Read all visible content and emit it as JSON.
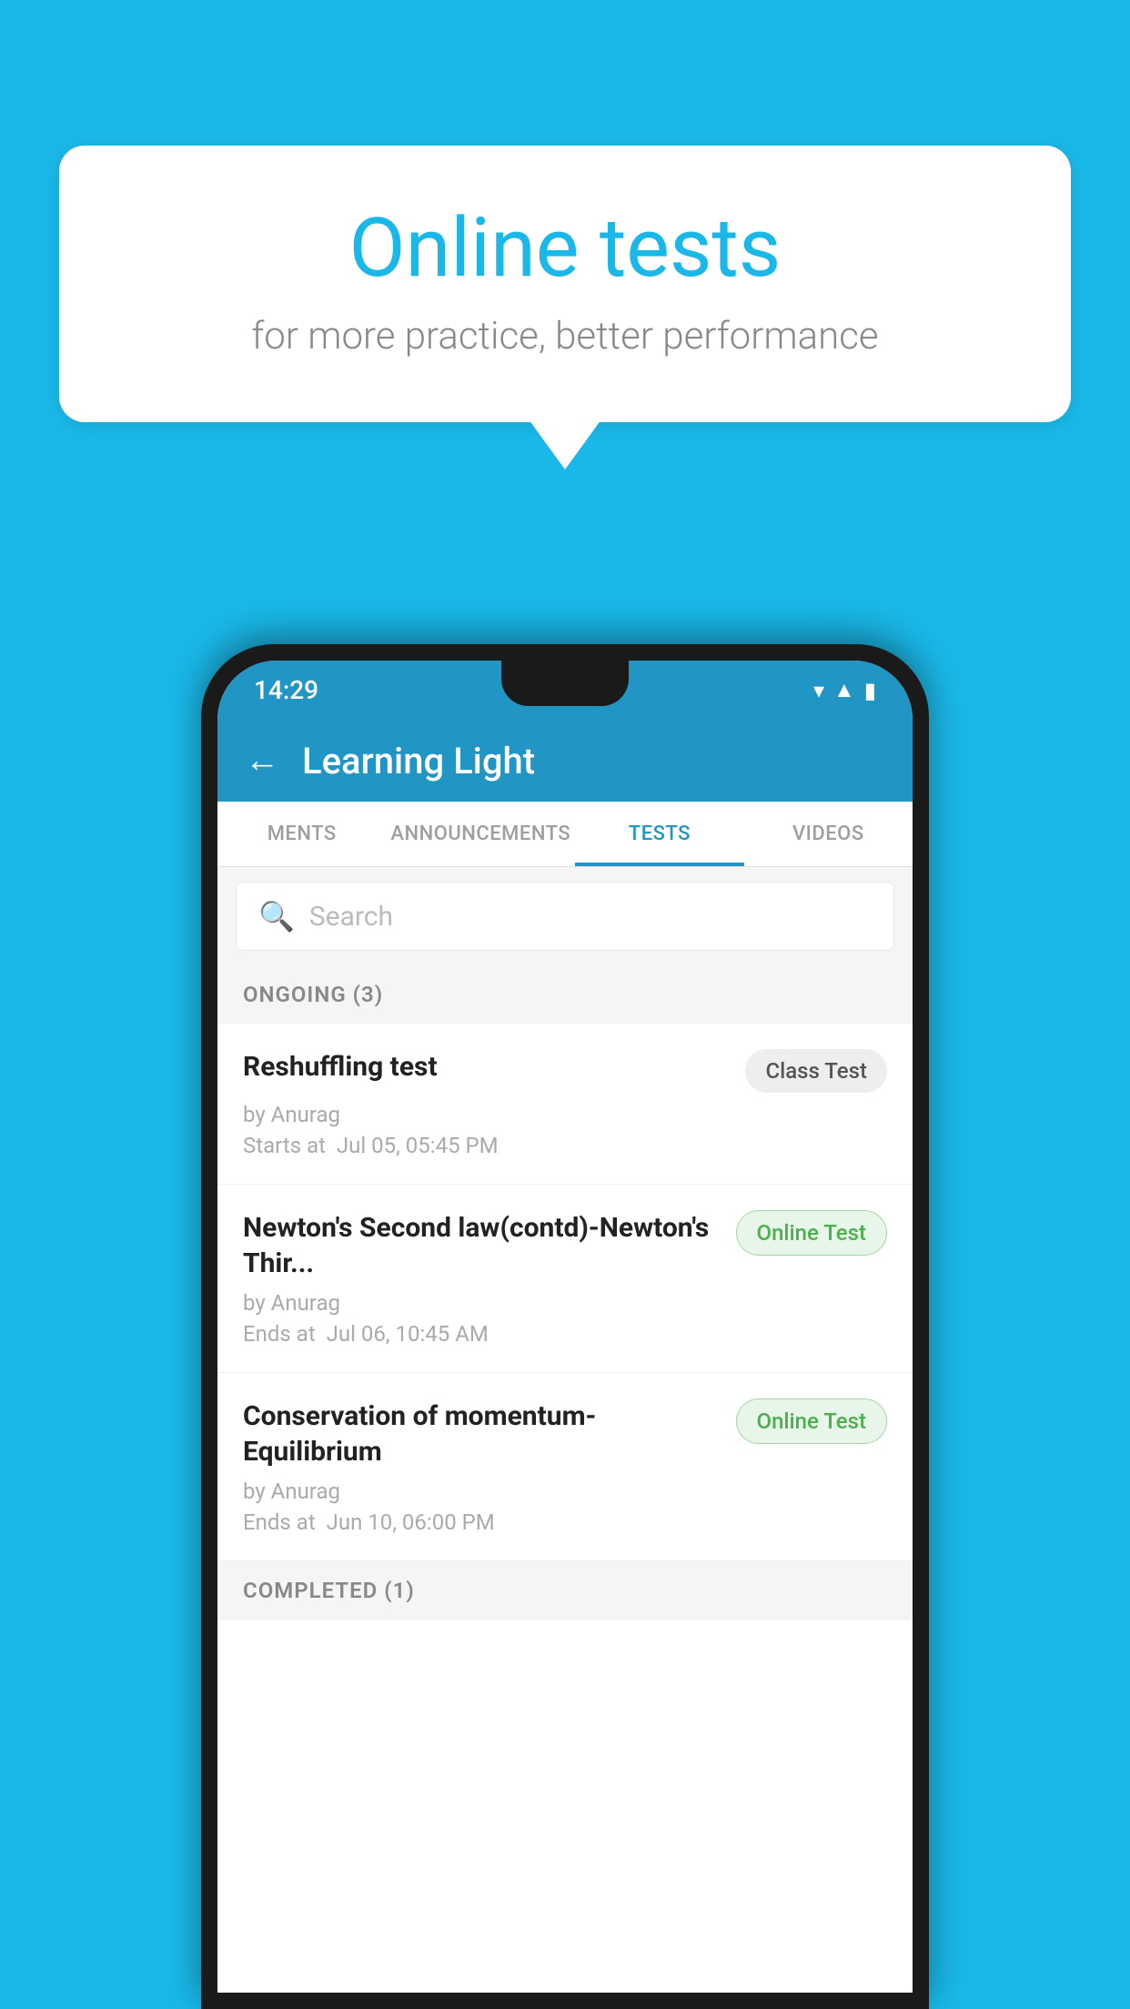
{
  "background": {
    "color": "#1ab8e8"
  },
  "speech_bubble": {
    "title": "Online tests",
    "subtitle": "for more practice, better performance"
  },
  "phone": {
    "status_bar": {
      "time": "14:29",
      "icons": [
        "wifi",
        "signal",
        "battery"
      ]
    },
    "app_bar": {
      "title": "Learning Light",
      "back_label": "←"
    },
    "tabs": [
      {
        "label": "MENTS",
        "active": false
      },
      {
        "label": "ANNOUNCEMENTS",
        "active": false
      },
      {
        "label": "TESTS",
        "active": true
      },
      {
        "label": "VIDEOS",
        "active": false
      }
    ],
    "search": {
      "placeholder": "Search"
    },
    "section": {
      "label": "ONGOING (3)"
    },
    "tests": [
      {
        "title": "Reshuffling test",
        "badge": "Class Test",
        "badge_type": "class",
        "by": "by Anurag",
        "time_label": "Starts at",
        "time": "Jul 05, 05:45 PM"
      },
      {
        "title": "Newton's Second law(contd)-Newton's Thir...",
        "badge": "Online Test",
        "badge_type": "online",
        "by": "by Anurag",
        "time_label": "Ends at",
        "time": "Jul 06, 10:45 AM"
      },
      {
        "title": "Conservation of momentum-Equilibrium",
        "badge": "Online Test",
        "badge_type": "online",
        "by": "by Anurag",
        "time_label": "Ends at",
        "time": "Jun 10, 06:00 PM"
      }
    ],
    "completed_section": {
      "label": "COMPLETED (1)"
    }
  }
}
